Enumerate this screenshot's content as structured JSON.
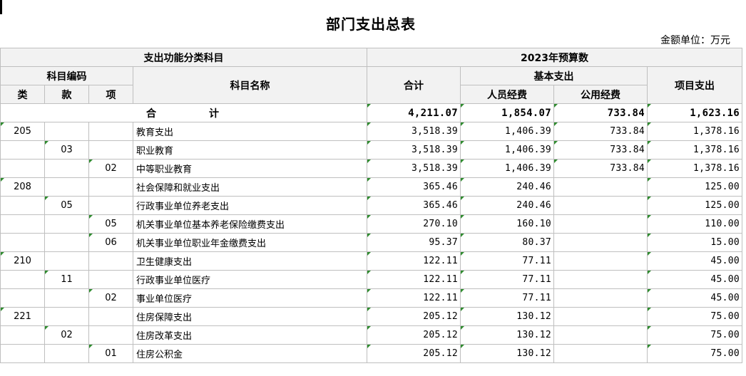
{
  "title": "部门支出总表",
  "unit": "金额单位：万元",
  "header": {
    "func_category": "支出功能分类科目",
    "year_budget": "2023年预算数",
    "code_group": "科目编码",
    "name": "科目名称",
    "total": "合计",
    "basic": "基本支出",
    "project": "项目支出",
    "lei": "类",
    "kuan": "款",
    "xiang": "项",
    "personnel": "人员经费",
    "public": "公用经费"
  },
  "total_row": {
    "label": "合　计",
    "total": "4,211.07",
    "personnel": "1,854.07",
    "public": "733.84",
    "project": "1,623.16"
  },
  "rows": [
    {
      "lei": "205",
      "kuan": "",
      "xiang": "",
      "name": "教育支出",
      "total": "3,518.39",
      "personnel": "1,406.39",
      "public": "733.84",
      "project": "1,378.16"
    },
    {
      "lei": "",
      "kuan": "03",
      "xiang": "",
      "name": "职业教育",
      "total": "3,518.39",
      "personnel": "1,406.39",
      "public": "733.84",
      "project": "1,378.16"
    },
    {
      "lei": "",
      "kuan": "",
      "xiang": "02",
      "name": "中等职业教育",
      "total": "3,518.39",
      "personnel": "1,406.39",
      "public": "733.84",
      "project": "1,378.16"
    },
    {
      "lei": "208",
      "kuan": "",
      "xiang": "",
      "name": "社会保障和就业支出",
      "total": "365.46",
      "personnel": "240.46",
      "public": "",
      "project": "125.00"
    },
    {
      "lei": "",
      "kuan": "05",
      "xiang": "",
      "name": "行政事业单位养老支出",
      "total": "365.46",
      "personnel": "240.46",
      "public": "",
      "project": "125.00"
    },
    {
      "lei": "",
      "kuan": "",
      "xiang": "05",
      "name": "机关事业单位基本养老保险缴费支出",
      "total": "270.10",
      "personnel": "160.10",
      "public": "",
      "project": "110.00"
    },
    {
      "lei": "",
      "kuan": "",
      "xiang": "06",
      "name": "机关事业单位职业年金缴费支出",
      "total": "95.37",
      "personnel": "80.37",
      "public": "",
      "project": "15.00"
    },
    {
      "lei": "210",
      "kuan": "",
      "xiang": "",
      "name": "卫生健康支出",
      "total": "122.11",
      "personnel": "77.11",
      "public": "",
      "project": "45.00"
    },
    {
      "lei": "",
      "kuan": "11",
      "xiang": "",
      "name": "行政事业单位医疗",
      "total": "122.11",
      "personnel": "77.11",
      "public": "",
      "project": "45.00"
    },
    {
      "lei": "",
      "kuan": "",
      "xiang": "02",
      "name": "事业单位医疗",
      "total": "122.11",
      "personnel": "77.11",
      "public": "",
      "project": "45.00"
    },
    {
      "lei": "221",
      "kuan": "",
      "xiang": "",
      "name": "住房保障支出",
      "total": "205.12",
      "personnel": "130.12",
      "public": "",
      "project": "75.00"
    },
    {
      "lei": "",
      "kuan": "02",
      "xiang": "",
      "name": "住房改革支出",
      "total": "205.12",
      "personnel": "130.12",
      "public": "",
      "project": "75.00"
    },
    {
      "lei": "",
      "kuan": "",
      "xiang": "01",
      "name": "住房公积金",
      "total": "205.12",
      "personnel": "130.12",
      "public": "",
      "project": "75.00"
    }
  ]
}
